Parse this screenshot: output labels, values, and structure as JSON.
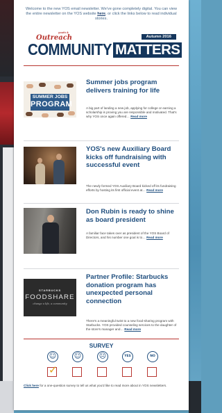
{
  "intro": {
    "text_before": "Welcome to the new YOS email newsletter. We've gone completely digital. You can view the entire newsletter on the YOS website ",
    "link": "here",
    "text_after": ", or click the links below to read individual stories."
  },
  "masthead": {
    "outreach": "Outreach",
    "outreach_sub": "youth &",
    "edition": "Autumn 2016",
    "title_left": "COMMUNITY",
    "title_right": "MATTERS"
  },
  "stories": [
    {
      "headline": "Summer jobs program delivers training for life",
      "summary": "A big part of landing a new job, applying for college or earning a scholarship is proving you are responsible and motivated. That's why YOS once again offered…",
      "read_more": "Read more",
      "thumb_line1": "SUMMER JOBS",
      "thumb_line2": "PROGRAM"
    },
    {
      "headline": "YOS's new Auxiliary Board kicks off fundraising with successful event",
      "summary": "The newly formed YOS Auxiliary Board kicked off its fundraising efforts by hosting its first official event at…",
      "read_more": "Read more"
    },
    {
      "headline": "Don Rubin is ready to shine as board president",
      "summary": "A familiar face takes over as president of the YOS Board of Directors, and his number one goal is to…",
      "read_more": "Read more"
    },
    {
      "headline": "Partner Profile: Starbucks donation program has unexpected personal connection",
      "summary": "There's a meaningful twist to a new food-sharing program with Starbucks. YOS provided counseling services to the daughter of the store's manager and…",
      "read_more": "Read more",
      "thumb_line1": "STARBUCKS",
      "thumb_line2": "FOODSHARE",
      "thumb_line3": "change a life, a community"
    }
  ],
  "survey": {
    "title": "SURVEY",
    "options": [
      {
        "icon": "happy-face-icon",
        "glyph": "☺",
        "checked": true
      },
      {
        "icon": "neutral-face-icon",
        "glyph": "☺",
        "checked": false
      },
      {
        "icon": "sad-face-icon",
        "glyph": "☹",
        "checked": false
      },
      {
        "icon": "yes-icon",
        "glyph": "YES",
        "checked": false
      },
      {
        "icon": "no-icon",
        "glyph": "NO",
        "checked": false
      }
    ],
    "check_glyph": "✓",
    "note_link": "Click here",
    "note_text": " for a one-question survey to tell us what you'd like to read more about in YOS newsletters."
  },
  "colors": {
    "brand_navy": "#14365c",
    "accent_red": "#b8352f",
    "link_blue": "#1f4e7e",
    "background_blue": "#5f9ebd"
  }
}
